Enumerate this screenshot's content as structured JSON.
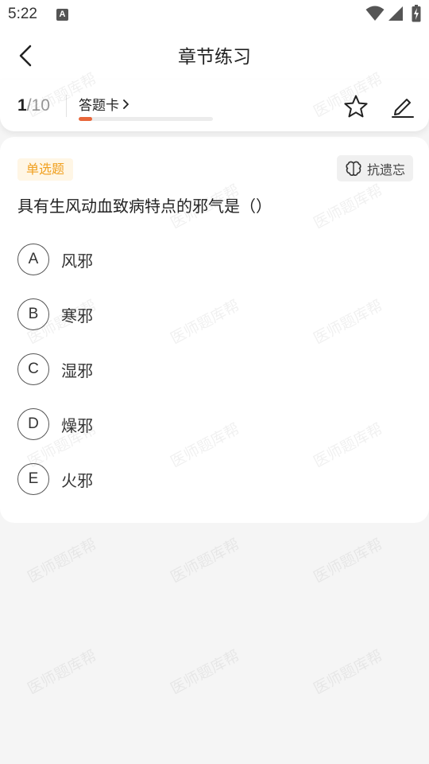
{
  "status_bar": {
    "time": "5:22",
    "a_icon": "A"
  },
  "header": {
    "title": "章节练习"
  },
  "progress": {
    "current": "1",
    "total": "/10",
    "answer_card_label": "答题卡",
    "fraction": 0.1,
    "accent_color": "#e8663a"
  },
  "question": {
    "type_label": "单选题",
    "anti_forget_label": "抗遗忘",
    "text": "具有生风动血致病特点的邪气是（）",
    "options": [
      {
        "letter": "A",
        "label": "风邪"
      },
      {
        "letter": "B",
        "label": "寒邪"
      },
      {
        "letter": "C",
        "label": "湿邪"
      },
      {
        "letter": "D",
        "label": "燥邪"
      },
      {
        "letter": "E",
        "label": "火邪"
      }
    ]
  },
  "watermark": {
    "text": "医师题库帮"
  }
}
